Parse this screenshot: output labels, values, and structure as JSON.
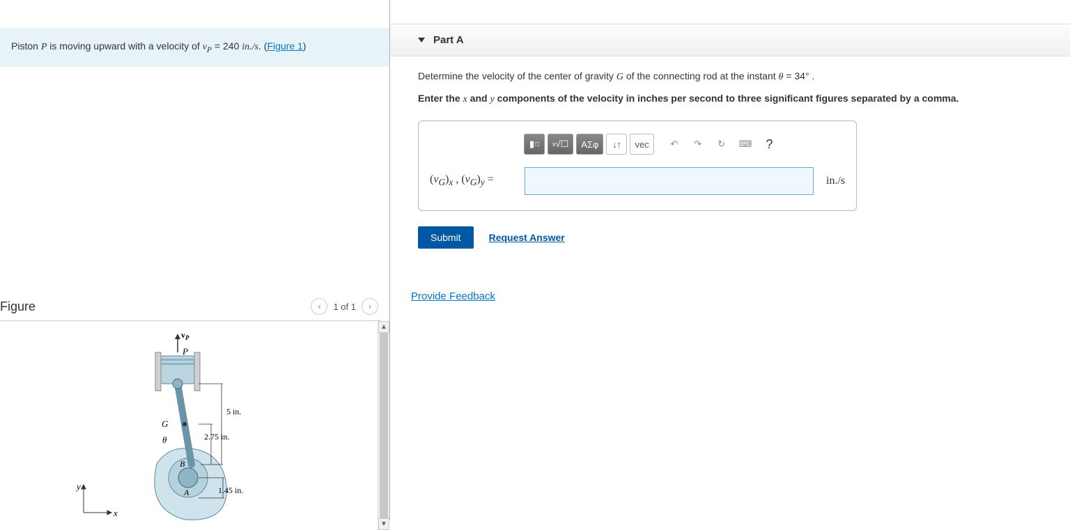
{
  "problem": {
    "text_prefix": "Piston ",
    "var_P": "P",
    "text_mid1": " is moving upward with a velocity of ",
    "var_vP": "v",
    "sub_P": "P",
    "equals": " = 240 ",
    "unit": "in./s",
    "period": ". (",
    "figure_link": "Figure 1",
    "close": ")"
  },
  "figure": {
    "title": "Figure",
    "page": "1 of 1",
    "labels": {
      "vP": "v",
      "vPsub": "P",
      "P": "P",
      "G": "G",
      "theta": "θ",
      "B": "B",
      "A": "A",
      "d5": "5 in.",
      "d275": "2.75 in.",
      "d145": "1.45 in.",
      "y": "y",
      "x": "x"
    }
  },
  "part": {
    "title": "Part A",
    "question_prefix": "Determine the velocity of the center of gravity ",
    "var_G": "G",
    "question_mid": " of the connecting rod at the instant ",
    "var_theta": "θ",
    "question_eq": " = 34°",
    "question_end": " .",
    "instruction_prefix": "Enter the ",
    "var_x": "x",
    "instruction_and": " and ",
    "var_y": "y",
    "instruction_suffix": " components of the velocity in inches per second to three significant figures separated by a comma.",
    "toolbar": {
      "templates": "▮",
      "sqrt": "√☐",
      "greek": "ΑΣφ",
      "updown": "↓↑",
      "vec": "vec",
      "undo": "↶",
      "redo": "↷",
      "reset": "↻",
      "keyboard": "⌨",
      "help": "?"
    },
    "answer_label": "(v_G)_x , (v_G)_y =",
    "unit": "in./s",
    "submit": "Submit",
    "request": "Request Answer"
  },
  "feedback": "Provide Feedback"
}
